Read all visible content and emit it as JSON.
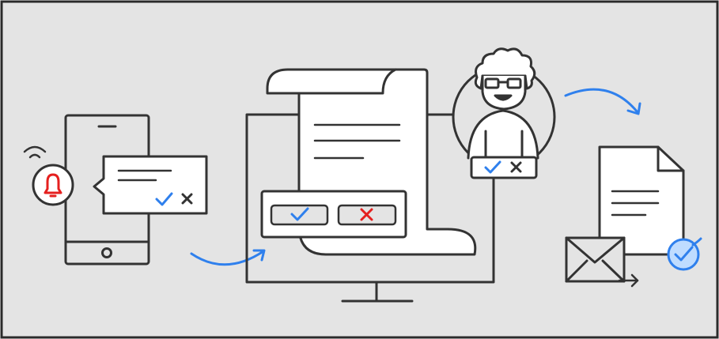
{
  "colors": {
    "background": "#e4e4e4",
    "border": "#2b2b2b",
    "stroke": "#333333",
    "accent_blue": "#2f80ed",
    "alert_red": "#e5201f",
    "white": "#ffffff",
    "check_bg": "#bfdcff"
  },
  "steps": [
    {
      "icon": "phone-notification-icon"
    },
    {
      "icon": "monitor-document-approval-icon"
    },
    {
      "icon": "reviewer-avatar-icon"
    },
    {
      "icon": "approved-document-email-icon"
    }
  ],
  "icons": {
    "bell": "bell-icon",
    "check": "check-icon",
    "close": "close-icon",
    "mail": "envelope-icon",
    "arrow": "curved-arrow-icon"
  }
}
